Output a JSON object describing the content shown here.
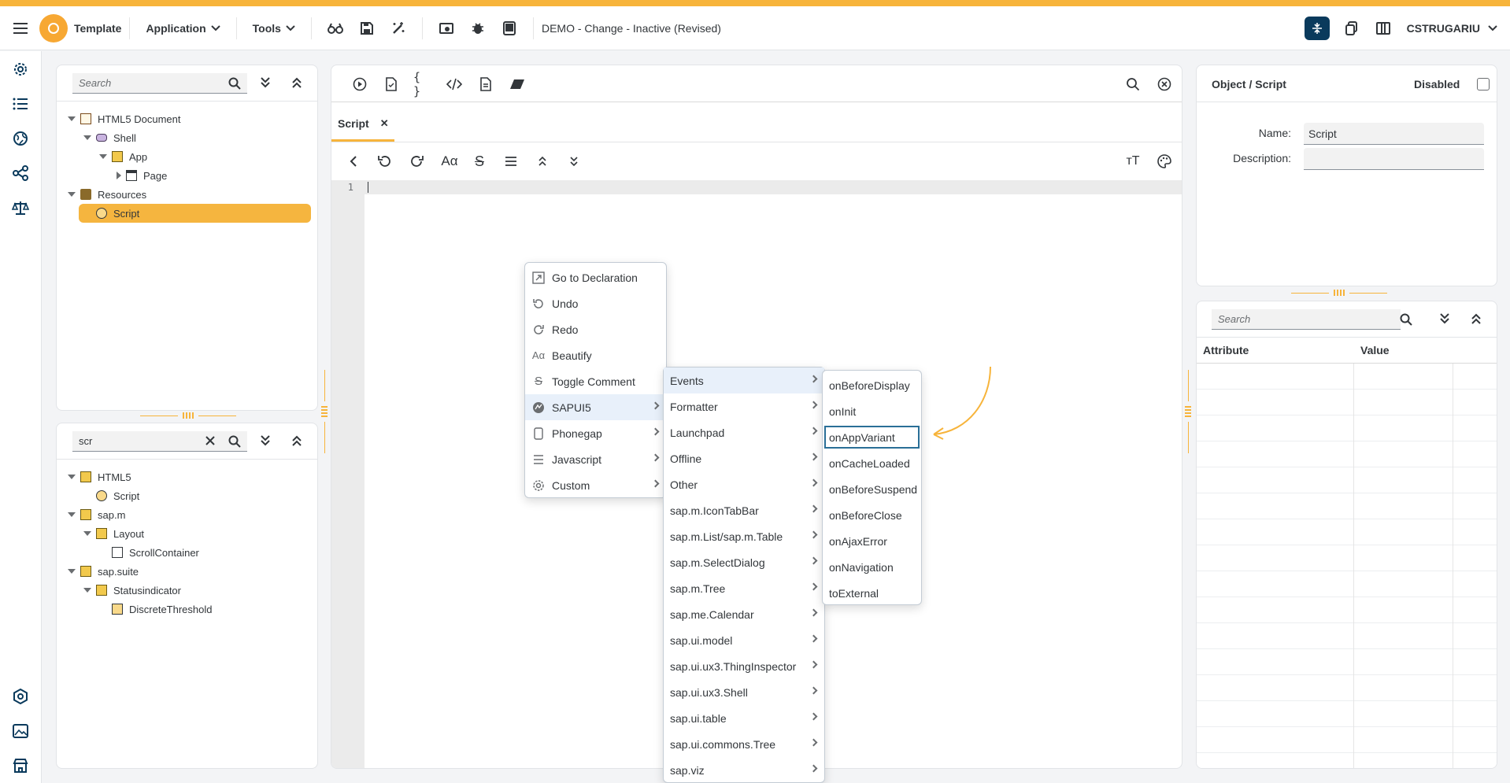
{
  "shellbar": {
    "app_title": "Template",
    "menu_application": "Application",
    "menu_tools": "Tools",
    "doc_title": "DEMO - Change - Inactive (Revised)",
    "user": "CSTRUGARIU",
    "accent": "#f7b43b"
  },
  "left_nav": [
    "gear-icon",
    "list-icon",
    "globe-icon",
    "share-icon",
    "balance-icon",
    "hexagon-icon",
    "image-icon",
    "store-icon"
  ],
  "tree_top": {
    "search_placeholder": "Search",
    "nodes": [
      {
        "label": "HTML5 Document"
      },
      {
        "label": "Shell"
      },
      {
        "label": "App"
      },
      {
        "label": "Page"
      },
      {
        "label": "Resources"
      },
      {
        "label": "Script"
      }
    ]
  },
  "tree_bottom": {
    "search_value": "scr",
    "nodes": [
      {
        "label": "HTML5"
      },
      {
        "label": "Script"
      },
      {
        "label": "sap.m"
      },
      {
        "label": "Layout"
      },
      {
        "label": "ScrollContainer"
      },
      {
        "label": "sap.suite"
      },
      {
        "label": "Statusindicator"
      },
      {
        "label": "DiscreteThreshold"
      }
    ]
  },
  "editor": {
    "tab_label": "Script",
    "line_number": "1"
  },
  "context_menu": {
    "items": [
      {
        "label": "Go to Declaration",
        "icon": "goto-icon"
      },
      {
        "label": "Undo",
        "icon": "undo-icon"
      },
      {
        "label": "Redo",
        "icon": "redo-icon"
      },
      {
        "label": "Beautify",
        "icon": "text-format-icon"
      },
      {
        "label": "Toggle Comment",
        "icon": "strikethrough-icon"
      },
      {
        "label": "SAPUI5",
        "icon": "sapui5-icon"
      },
      {
        "label": "Phonegap",
        "icon": "phone-icon"
      },
      {
        "label": "Javascript",
        "icon": "list-icon"
      },
      {
        "label": "Custom",
        "icon": "gear-icon"
      }
    ]
  },
  "submenu_sapui5": {
    "items": [
      "Events",
      "Formatter",
      "Launchpad",
      "Offline",
      "Other",
      "sap.m.IconTabBar",
      "sap.m.List/sap.m.Table",
      "sap.m.SelectDialog",
      "sap.m.Tree",
      "sap.me.Calendar",
      "sap.ui.model",
      "sap.ui.ux3.ThingInspector",
      "sap.ui.ux3.Shell",
      "sap.ui.table",
      "sap.ui.commons.Tree",
      "sap.viz"
    ]
  },
  "submenu_events": {
    "items": [
      "onBeforeDisplay",
      "onInit",
      "onAppVariant",
      "onCacheLoaded",
      "onBeforeSuspend",
      "onBeforeClose",
      "onAjaxError",
      "onNavigation",
      "toExternal"
    ]
  },
  "properties": {
    "title": "Object / Script",
    "disabled_label": "Disabled",
    "name_label": "Name:",
    "name_value": "Script",
    "description_label": "Description:",
    "description_value": ""
  },
  "attributes": {
    "search_placeholder": "Search",
    "col_attribute": "Attribute",
    "col_value": "Value"
  }
}
